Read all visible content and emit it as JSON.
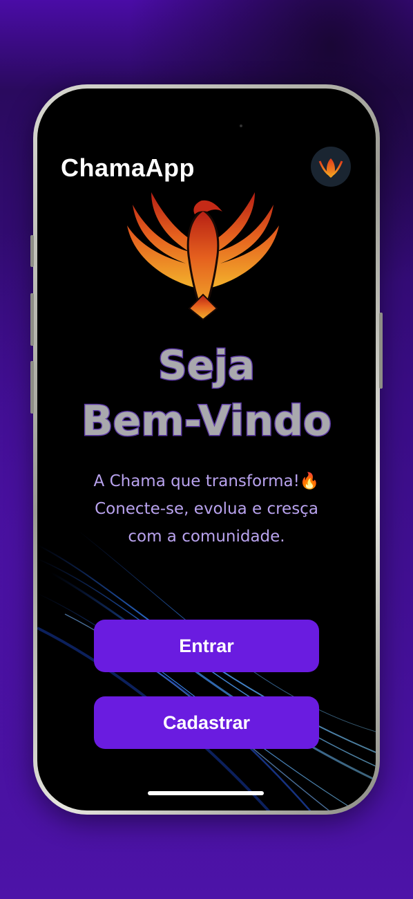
{
  "app": {
    "title": "ChamaApp"
  },
  "header": {
    "avatar_icon": "phoenix-icon"
  },
  "hero": {
    "logo_icon": "phoenix-logo",
    "headline_line1": "Seja",
    "headline_line2": "Bem-Vindo",
    "tagline_line1": "A Chama que transforma!🔥",
    "tagline_line2": "Conecte-se, evolua e cresça",
    "tagline_line3": "com a comunidade."
  },
  "actions": {
    "login_label": "Entrar",
    "signup_label": "Cadastrar"
  },
  "colors": {
    "button": "#6a1ce0",
    "headline_fill": "#a9a9ad",
    "headline_stroke": "#5d3aa6",
    "tagline": "#b9a3ee",
    "background": "#3a0d86"
  }
}
